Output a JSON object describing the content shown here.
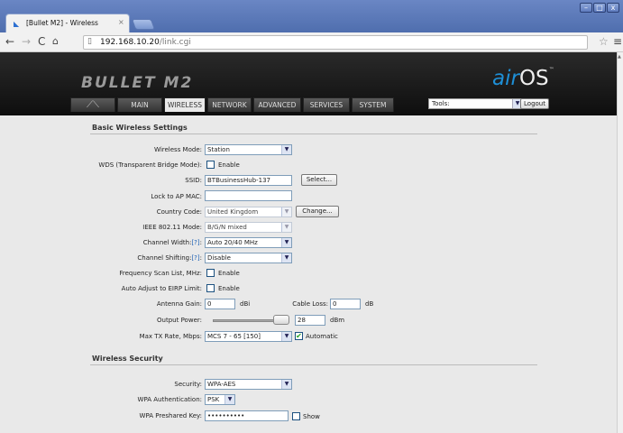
{
  "browser": {
    "tab_title": "[Bullet M2] - Wireless",
    "url_host": "192.168.10.20",
    "url_path": "/link.cgi"
  },
  "header": {
    "product_logo": "BULLET M2",
    "os_logo_air": "air",
    "os_logo_os": "OS",
    "os_logo_tm": "™",
    "tabs": [
      "MAIN",
      "WIRELESS",
      "NETWORK",
      "ADVANCED",
      "SERVICES",
      "SYSTEM"
    ],
    "active_tab": "WIRELESS",
    "tools_value": "Tools:",
    "logout_label": "Logout"
  },
  "basic": {
    "title": "Basic Wireless Settings",
    "wireless_mode_label": "Wireless Mode:",
    "wireless_mode_value": "Station",
    "wds_label": "WDS (Transparent Bridge Mode):",
    "wds_cb_label": "Enable",
    "ssid_label": "SSID:",
    "ssid_value": "BTBusinessHub-137",
    "select_label": "Select...",
    "lock_label": "Lock to AP MAC:",
    "lock_value": "",
    "country_label": "Country Code:",
    "country_value": "United Kingdom",
    "change_label": "Change...",
    "ieee_label": "IEEE 802.11 Mode:",
    "ieee_value": "B/G/N mixed",
    "width_label_pre": "Channel Width:",
    "width_help": "[?]",
    "width_value": "Auto 20/40 MHz",
    "shift_label_pre": "Channel Shifting:",
    "shift_help": "[?]",
    "shift_value": "Disable",
    "freq_label": "Frequency Scan List, MHz:",
    "freq_cb_label": "Enable",
    "eirp_label": "Auto Adjust to EIRP Limit:",
    "eirp_cb_label": "Enable",
    "antenna_label": "Antenna Gain:",
    "antenna_value": "0",
    "antenna_unit": "dBi",
    "cable_label": "Cable Loss:",
    "cable_value": "0",
    "cable_unit": "dB",
    "power_label": "Output Power:",
    "power_value": "28",
    "power_unit": "dBm",
    "power_level": 0.95,
    "tx_label": "Max TX Rate, Mbps:",
    "tx_value": "MCS 7 - 65 [150]",
    "auto_label": "Automatic",
    "auto_checked": true
  },
  "security": {
    "title": "Wireless Security",
    "security_label": "Security:",
    "security_value": "WPA-AES",
    "auth_label": "WPA Authentication:",
    "auth_value": "PSK",
    "key_label": "WPA Preshared Key:",
    "key_value": "••••••••••",
    "show_label": "Show"
  }
}
